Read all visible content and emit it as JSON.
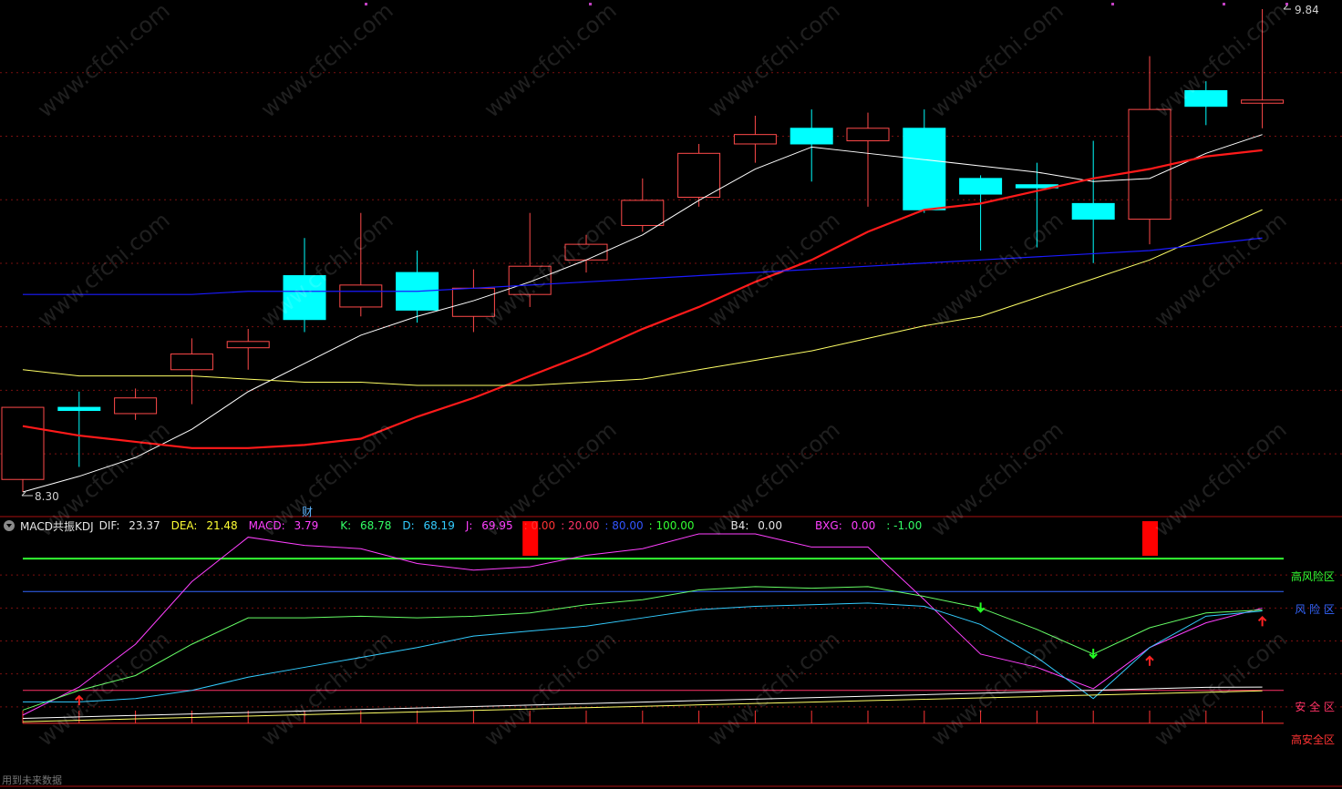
{
  "price_labels": {
    "high": "9.84",
    "low": "8.30"
  },
  "finance_marker": "财",
  "indicator_header": {
    "name": "MACD共振KDJ",
    "dif_label": "DIF:",
    "dif_value": "23.37",
    "dea_label": "DEA:",
    "dea_value": "21.48",
    "macd_label": "MACD:",
    "macd_value": "3.79",
    "k_label": "K:",
    "k_value": "68.78",
    "d_label": "D:",
    "d_value": "68.19",
    "j_label": "J:",
    "j_value": "69.95",
    "level_0": ": 0.00",
    "level_20": ": 20.00",
    "level_80": ": 80.00",
    "level_100": ": 100.00",
    "b4_label": "B4:",
    "b4_value": "0.00",
    "bxg_label": "BXG:",
    "bxg_value": "0.00",
    "bxg_extra": ": -1.00"
  },
  "zone_labels": {
    "high_risk": "高风险区",
    "risk": "风 险 区",
    "safe": "安 全 区",
    "high_safe": "高安全区"
  },
  "footer_text": "用到未来数据",
  "watermark_text": "www.cfchi.com",
  "colors": {
    "up": "#ff4a4a",
    "down": "#00ffff",
    "ma5": "#ffffff",
    "ma10": "#ff1a1a",
    "ma20": "#ffff66",
    "ma60": "#1a1aff",
    "dif": "#ff40ff",
    "dea": "#66ff66",
    "kdj": "#33ccff",
    "high_risk": "#33ff33",
    "risk": "#3366ff",
    "safe": "#ff3366"
  },
  "chart_data": [
    {
      "type": "candlestick",
      "title": "",
      "ylim": [
        8.3,
        9.84
      ],
      "candles": [
        {
          "o": 8.34,
          "c": 8.57,
          "h": 8.57,
          "l": 8.3
        },
        {
          "o": 8.57,
          "c": 8.56,
          "h": 8.62,
          "l": 8.38
        },
        {
          "o": 8.55,
          "c": 8.6,
          "h": 8.63,
          "l": 8.53
        },
        {
          "o": 8.69,
          "c": 8.74,
          "h": 8.79,
          "l": 8.58
        },
        {
          "o": 8.76,
          "c": 8.78,
          "h": 8.82,
          "l": 8.69
        },
        {
          "o": 8.99,
          "c": 8.85,
          "h": 9.11,
          "l": 8.81
        },
        {
          "o": 8.89,
          "c": 8.96,
          "h": 9.19,
          "l": 8.86
        },
        {
          "o": 9.0,
          "c": 8.88,
          "h": 9.07,
          "l": 8.84
        },
        {
          "o": 8.86,
          "c": 8.95,
          "h": 9.01,
          "l": 8.81
        },
        {
          "o": 8.93,
          "c": 9.02,
          "h": 9.19,
          "l": 8.89
        },
        {
          "o": 9.04,
          "c": 9.09,
          "h": 9.12,
          "l": 9.0
        },
        {
          "o": 9.15,
          "c": 9.23,
          "h": 9.3,
          "l": 9.13
        },
        {
          "o": 9.24,
          "c": 9.38,
          "h": 9.41,
          "l": 9.21
        },
        {
          "o": 9.41,
          "c": 9.44,
          "h": 9.5,
          "l": 9.35
        },
        {
          "o": 9.46,
          "c": 9.41,
          "h": 9.52,
          "l": 9.29
        },
        {
          "o": 9.42,
          "c": 9.46,
          "h": 9.51,
          "l": 9.21
        },
        {
          "o": 9.46,
          "c": 9.2,
          "h": 9.52,
          "l": 9.19
        },
        {
          "o": 9.3,
          "c": 9.25,
          "h": 9.31,
          "l": 9.07
        },
        {
          "o": 9.28,
          "c": 9.27,
          "h": 9.35,
          "l": 9.08
        },
        {
          "o": 9.22,
          "c": 9.17,
          "h": 9.42,
          "l": 9.03
        },
        {
          "o": 9.17,
          "c": 9.52,
          "h": 9.69,
          "l": 9.09
        },
        {
          "o": 9.58,
          "c": 9.53,
          "h": 9.61,
          "l": 9.47
        },
        {
          "o": 9.54,
          "c": 9.55,
          "h": 9.84,
          "l": 9.46
        }
      ],
      "series": [
        {
          "values": [
            8.3,
            8.35,
            8.41,
            8.5,
            8.62,
            8.71,
            8.8,
            8.86,
            8.91,
            8.97,
            9.04,
            9.12,
            9.23,
            9.33,
            9.4,
            9.38,
            9.36,
            9.34,
            9.32,
            9.29,
            9.3,
            9.38,
            9.44
          ]
        },
        {
          "values": [
            8.51,
            8.48,
            8.46,
            8.44,
            8.44,
            8.45,
            8.47,
            8.54,
            8.6,
            8.67,
            8.74,
            8.82,
            8.89,
            8.97,
            9.04,
            9.13,
            9.2,
            9.22,
            9.26,
            9.3,
            9.33,
            9.37,
            9.39
          ]
        },
        {
          "values": [
            8.69,
            8.67,
            8.67,
            8.67,
            8.66,
            8.65,
            8.65,
            8.64,
            8.64,
            8.64,
            8.65,
            8.66,
            8.69,
            8.72,
            8.75,
            8.79,
            8.83,
            8.86,
            8.92,
            8.98,
            9.04,
            9.12,
            9.2
          ]
        },
        {
          "values": [
            8.93,
            8.93,
            8.93,
            8.93,
            8.94,
            8.94,
            8.94,
            8.94,
            8.95,
            8.96,
            8.97,
            8.98,
            8.99,
            9.0,
            9.01,
            9.02,
            9.03,
            9.04,
            9.05,
            9.06,
            9.07,
            9.09,
            9.11
          ]
        }
      ]
    },
    {
      "type": "line",
      "title": "MACD共振KDJ",
      "ylim": [
        -10,
        110
      ],
      "reference_lines": [
        100,
        80,
        20,
        0
      ],
      "series": [
        {
          "name": "DIF",
          "values": [
            5,
            22,
            48,
            86,
            113,
            108,
            106,
            97,
            93,
            95,
            102,
            106,
            115,
            115,
            107,
            107,
            75,
            42,
            34,
            21,
            46,
            61,
            69.95
          ]
        },
        {
          "name": "DEA",
          "values": [
            8,
            20,
            29,
            48,
            64,
            64,
            65,
            64,
            65,
            67,
            72,
            75,
            81,
            83,
            82,
            83,
            77,
            70,
            57,
            42,
            58,
            67,
            68.78
          ]
        },
        {
          "name": "K",
          "values": [
            13,
            13,
            15,
            20,
            28,
            34,
            40,
            46,
            53,
            56,
            59,
            64,
            69,
            71,
            72,
            73,
            71,
            60,
            40,
            15,
            46,
            65,
            68.19
          ]
        }
      ],
      "signals": [
        {
          "category_index": 9,
          "value": 105
        },
        {
          "category_index": 20,
          "value": 105
        }
      ],
      "buy_arrows": [
        1,
        20,
        22
      ],
      "sell_arrows": [
        17,
        19
      ]
    }
  ]
}
